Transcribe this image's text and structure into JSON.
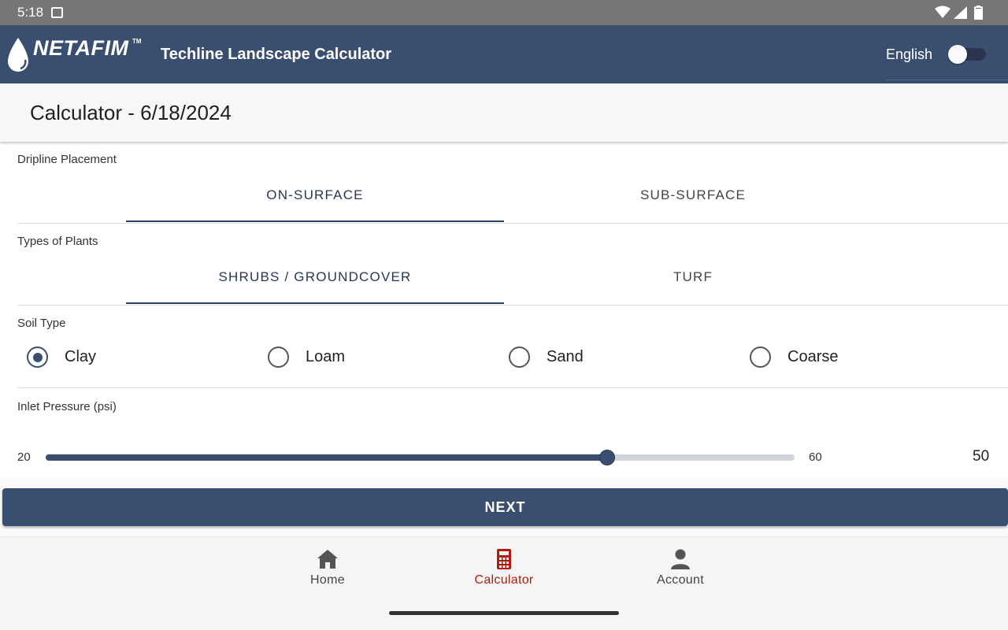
{
  "status": {
    "time": "5:18"
  },
  "appbar": {
    "brand": "NETAFIM",
    "trademark": "TM",
    "title": "Techline Landscape Calculator",
    "language": "English",
    "language_toggle_on": false
  },
  "page": {
    "title": "Calculator - 6/18/2024"
  },
  "dripline": {
    "label": "Dripline Placement",
    "tabs": [
      {
        "label": "ON-SURFACE",
        "active": true
      },
      {
        "label": "SUB-SURFACE",
        "active": false
      }
    ]
  },
  "plants": {
    "label": "Types of Plants",
    "tabs": [
      {
        "label": "SHRUBS / GROUNDCOVER",
        "active": true
      },
      {
        "label": "TURF",
        "active": false
      }
    ]
  },
  "soil": {
    "label": "Soil Type",
    "options": [
      {
        "label": "Clay",
        "selected": true
      },
      {
        "label": "Loam",
        "selected": false
      },
      {
        "label": "Sand",
        "selected": false
      },
      {
        "label": "Coarse",
        "selected": false
      }
    ]
  },
  "pressure": {
    "label": "Inlet Pressure (psi)",
    "min": "20",
    "max": "60",
    "value": "50",
    "min_num": 20,
    "max_num": 60,
    "value_num": 50
  },
  "next_button": {
    "label": "NEXT"
  },
  "nav": {
    "items": [
      {
        "label": "Home",
        "icon": "home-icon",
        "active": false
      },
      {
        "label": "Calculator",
        "icon": "calculator-icon",
        "active": true
      },
      {
        "label": "Account",
        "icon": "account-icon",
        "active": false
      }
    ]
  },
  "colors": {
    "primary": "#3a4f70",
    "statusbar": "#767676",
    "nav_active": "#b01c0d",
    "track_inactive": "#cfd4dc"
  }
}
